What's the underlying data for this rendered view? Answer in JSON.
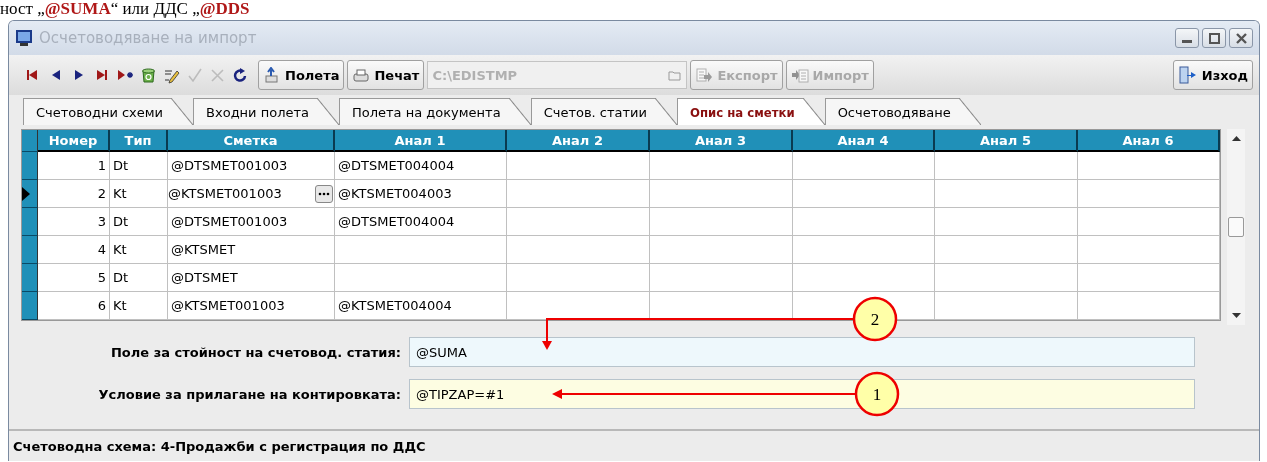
{
  "caption": "ност „**@SUMA**“ или ДДС „**@DDS**",
  "window": {
    "title": "Осчетоводяване на импорт"
  },
  "nav_tools": [
    {
      "kind": "first",
      "disabled": false
    },
    {
      "kind": "prev",
      "disabled": false
    },
    {
      "kind": "next",
      "disabled": false
    },
    {
      "kind": "last",
      "disabled": false
    },
    {
      "kind": "new",
      "disabled": false
    },
    {
      "kind": "delete",
      "disabled": false
    },
    {
      "kind": "edit",
      "disabled": false
    },
    {
      "kind": "confirm",
      "disabled": true
    },
    {
      "kind": "cancel",
      "disabled": true
    },
    {
      "kind": "refresh",
      "disabled": false
    }
  ],
  "buttons": [
    {
      "label": "Полета",
      "kind": "fields",
      "disabled": false
    },
    {
      "label": "Печат",
      "kind": "print",
      "disabled": false
    }
  ],
  "path_field": {
    "value": "C:\\EDISTMP",
    "disabled": true
  },
  "transfer_buttons": [
    {
      "label": "Експорт",
      "kind": "export",
      "disabled": true
    },
    {
      "label": "Импорт",
      "kind": "import",
      "disabled": true
    }
  ],
  "exit_button": {
    "label": "Изход"
  },
  "tabs": [
    {
      "label": "Счетоводни схеми",
      "selected": false
    },
    {
      "label": "Входни полета",
      "selected": false
    },
    {
      "label": "Полета на документа",
      "selected": false
    },
    {
      "label": "Счетов. статии",
      "selected": false
    },
    {
      "label": "Опис на сметки",
      "selected": true
    },
    {
      "label": "Осчетоводяване",
      "selected": false
    }
  ],
  "table": {
    "columns": [
      "Номер",
      "Тип",
      "Сметка",
      "Анал 1",
      "Анал 2",
      "Анал 3",
      "Анал 4",
      "Анал 5",
      "Анал 6"
    ],
    "rows": [
      {
        "selected": false,
        "editing": false,
        "cells": [
          "1",
          "Dt",
          "@DTSMET001003",
          "@DTSMET004004"
        ]
      },
      {
        "selected": true,
        "editing": true,
        "cells": [
          "2",
          "Kt",
          "@KTSMET001003",
          "@KTSMET004003"
        ]
      },
      {
        "selected": false,
        "editing": false,
        "cells": [
          "3",
          "Dt",
          "@DTSMET001003",
          "@DTSMET004004"
        ]
      },
      {
        "selected": false,
        "editing": false,
        "cells": [
          "4",
          "Kt",
          "@KTSMET"
        ]
      },
      {
        "selected": false,
        "editing": false,
        "cells": [
          "5",
          "Dt",
          "@DTSMET"
        ]
      },
      {
        "selected": false,
        "editing": false,
        "cells": [
          "6",
          "Kt",
          "@KTSMET001003",
          "@KTSMET004004"
        ]
      }
    ]
  },
  "fields": [
    {
      "label": "Поле за стойност на счетовод. статия:",
      "value": "@SUMA",
      "color": "#eef8fc",
      "callout": {
        "label": "2",
        "kind": "elbow"
      }
    },
    {
      "label": "Условие за прилагане на контировката:",
      "value": "@TIPZAP=#1",
      "color": "#fdfde2",
      "callout": {
        "label": "1",
        "kind": "straight"
      }
    }
  ],
  "status_bar": "Счетоводна схема: 4-Продажби с регистрация по ДДС"
}
